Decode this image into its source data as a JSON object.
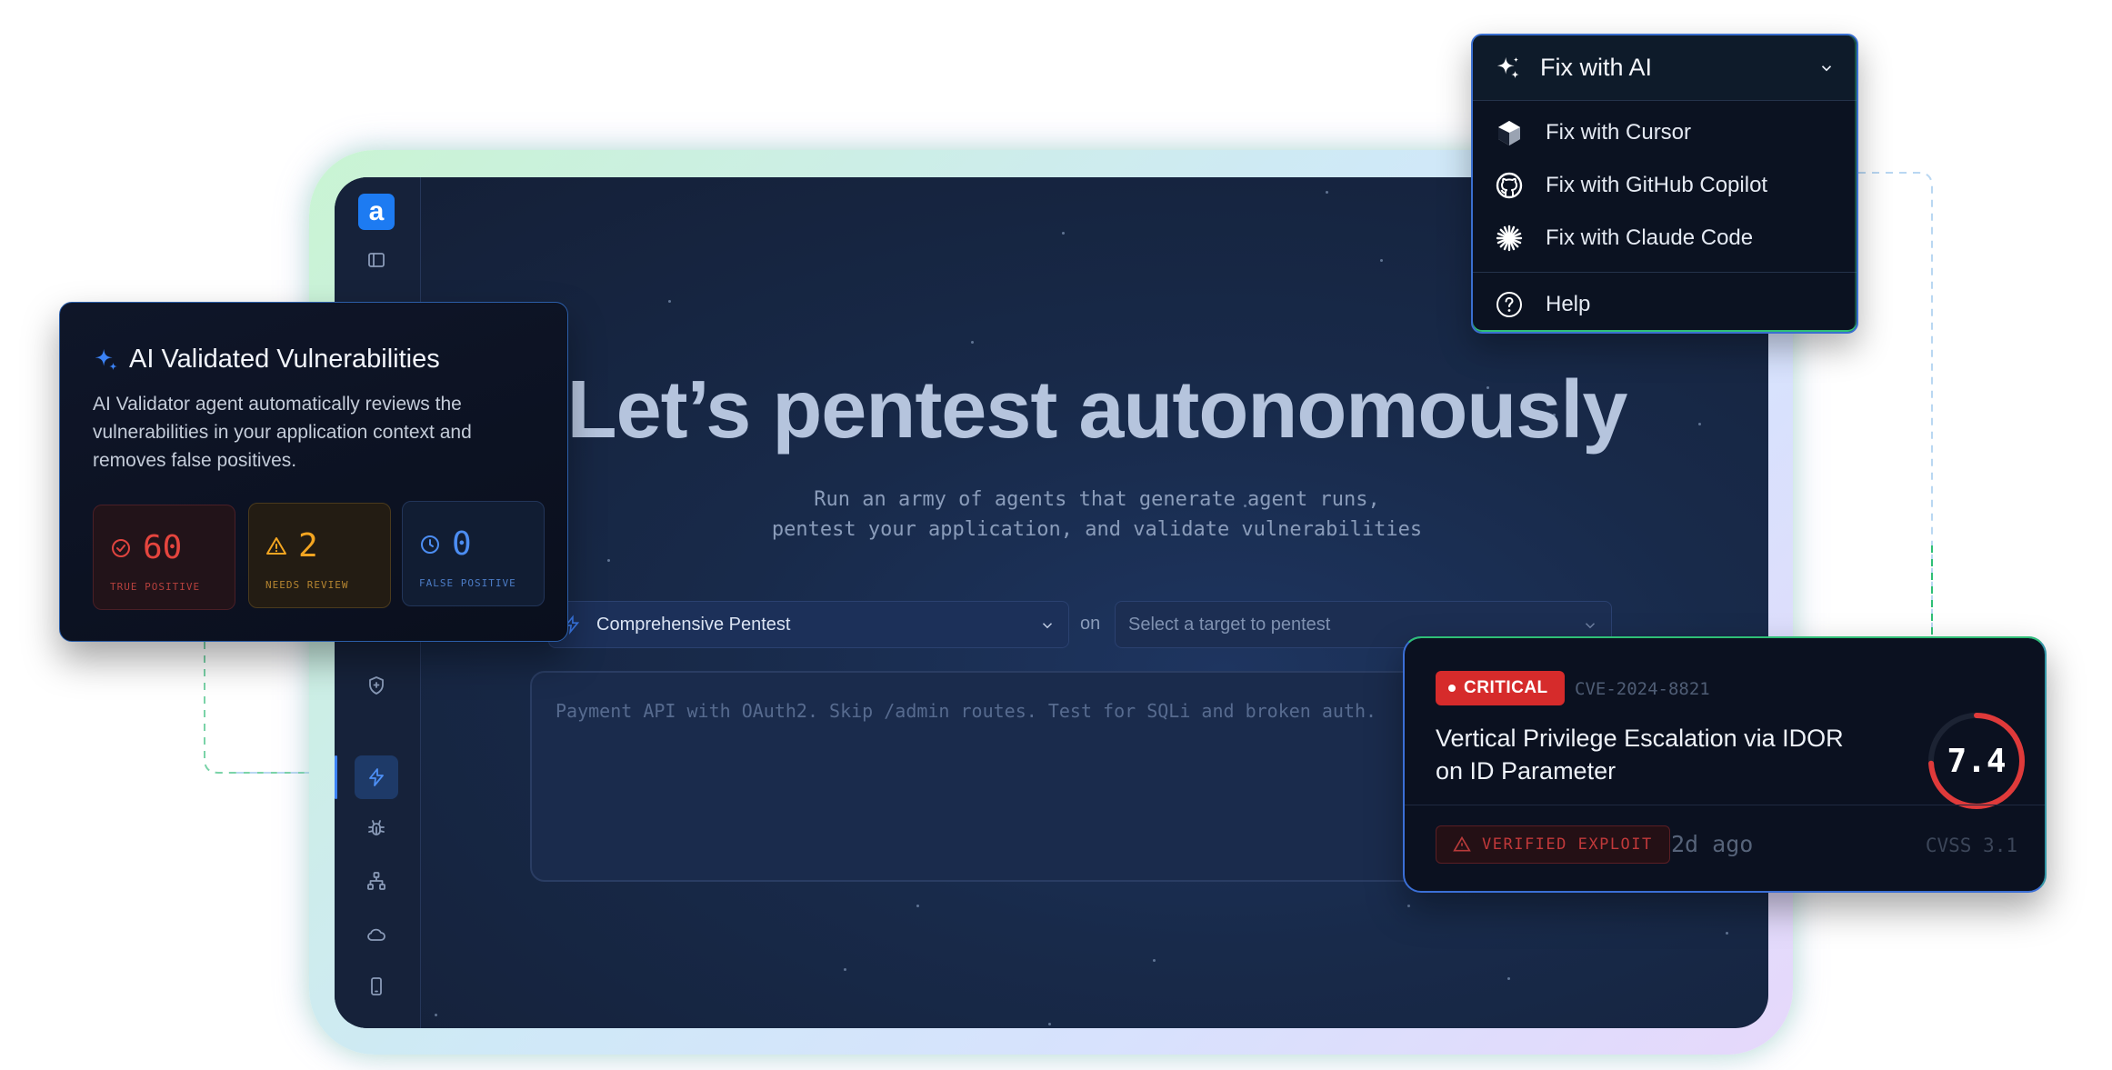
{
  "app": {
    "logo_letter": "a",
    "hero_title": "Let’s pentest autonomously",
    "hero_sub_line1": "Run an army of agents that generate agent runs,",
    "hero_sub_line2": "pentest your application, and validate vulnerabilities",
    "pentest_type": "Comprehensive Pentest",
    "on_label": "on",
    "target_placeholder": "Select a target to pentest",
    "prompt_placeholder": "Payment API with OAuth2. Skip /admin routes. Test for SQLi and broken auth.",
    "sidebar_icons": [
      "panel-toggle-icon",
      "grid-dots-icon",
      "shield-icon",
      "bolt-icon",
      "bug-icon",
      "network-icon",
      "cloud-icon",
      "mobile-icon"
    ],
    "active_sidebar_item": "bolt-icon"
  },
  "validated_card": {
    "title": "AI Validated Vulnerabilities",
    "description": "AI Validator agent automatically reviews the vulnerabilities in your application context and removes false positives.",
    "stats": [
      {
        "value": "60",
        "label": "TRUE POSITIVE",
        "icon": "check-circle-icon",
        "color": "#e5453e"
      },
      {
        "value": "2",
        "label": "NEEDS REVIEW",
        "icon": "warning-triangle-icon",
        "color": "#f3a521"
      },
      {
        "value": "0",
        "label": "FALSE POSITIVE",
        "icon": "clock-icon",
        "color": "#4c8df2"
      }
    ]
  },
  "fix_menu": {
    "title": "Fix with AI",
    "items": [
      {
        "label": "Fix with Cursor",
        "icon": "cursor-cube-icon"
      },
      {
        "label": "Fix with GitHub Copilot",
        "icon": "github-icon"
      },
      {
        "label": "Fix with Claude Code",
        "icon": "claude-burst-icon"
      }
    ],
    "help_label": "Help"
  },
  "cve_card": {
    "severity": "CRITICAL",
    "severity_color": "#d62b2b",
    "cve_id": "CVE-2024-8821",
    "title": "Vertical Privilege Escalation via IDOR on ID Parameter",
    "score": "7.4",
    "score_fraction": 0.74,
    "status": "VERIFIED EXPLOIT",
    "time": "2d ago",
    "standard": "CVSS 3.1"
  },
  "colors": {
    "accent_blue": "#1d7bf2",
    "frame_green": "#2fbf76",
    "critical_red": "#d62b2b"
  }
}
